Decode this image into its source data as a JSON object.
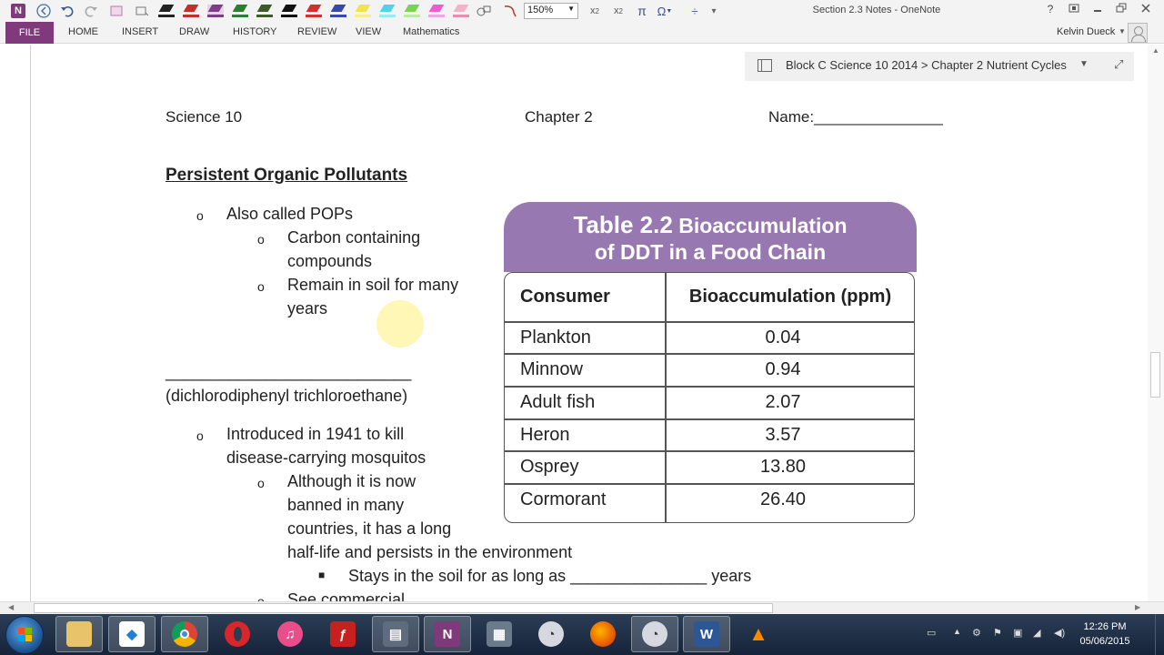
{
  "window": {
    "title": "Section 2.3 Notes - OneNote",
    "zoom": "150%",
    "help": "?"
  },
  "ribbon": {
    "tabs": [
      "FILE",
      "HOME",
      "INSERT",
      "DRAW",
      "HISTORY",
      "REVIEW",
      "VIEW",
      "Mathematics"
    ],
    "user": "Kelvin Dueck"
  },
  "colors": {
    "accent": "#80397b",
    "table_header": "#9878b0"
  },
  "notebook": {
    "breadcrumb": "Block C Science 10 2014 > Chapter 2 Nutrient Cycles"
  },
  "page": {
    "header_left": "Science 10",
    "header_center": "Chapter 2",
    "header_right": "Name:_______________",
    "heading": "Persistent Organic Pollutants",
    "items": [
      "Also called POPs",
      "Carbon containing",
      "compounds",
      "Remain in soil for many",
      "years",
      "___________________________",
      "(dichlorodiphenyl trichloroethane)",
      "Introduced in 1941 to kill",
      "disease-carrying mosquitos",
      "Although it is now",
      "banned in many",
      "countries, it has a long",
      "half-life and persists in the environment",
      "Stays in the soil for as long as _______________ years",
      "See commercial"
    ]
  },
  "table": {
    "title_number": "Table 2.2",
    "title_rest_line1": "Bioaccumulation",
    "title_line2": "of DDT in a Food Chain",
    "columns": [
      "Consumer",
      "Bioaccumulation (ppm)"
    ],
    "rows": [
      [
        "Plankton",
        "0.04"
      ],
      [
        "Minnow",
        "0.94"
      ],
      [
        "Adult fish",
        "2.07"
      ],
      [
        "Heron",
        "3.57"
      ],
      [
        "Osprey",
        "13.80"
      ],
      [
        "Cormorant",
        "26.40"
      ]
    ]
  },
  "taskbar": {
    "time": "12:26 PM",
    "date": "05/06/2015"
  }
}
